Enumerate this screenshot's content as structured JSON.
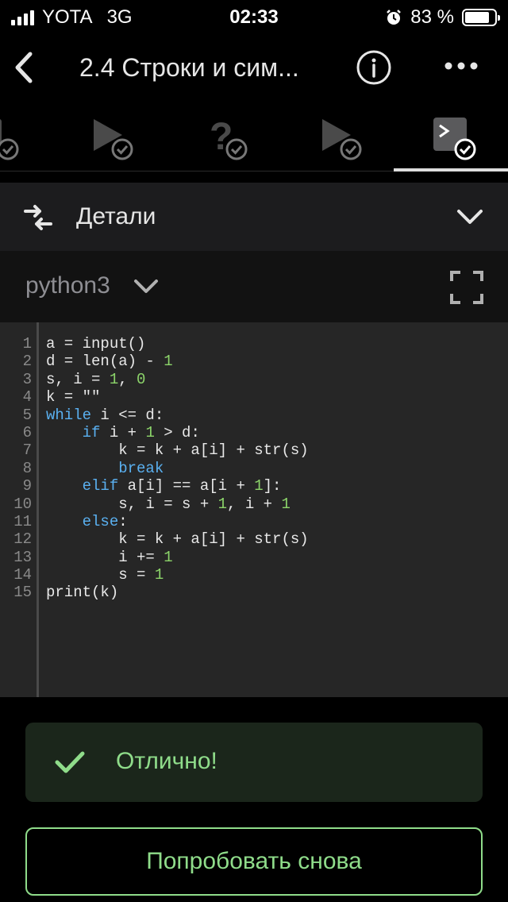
{
  "status_bar": {
    "carrier": "YOTA",
    "network": "3G",
    "time": "02:33",
    "battery_percent": "83 %",
    "battery_level": 0.83
  },
  "nav": {
    "title": "2.4 Строки и сим..."
  },
  "steps": [
    {
      "icon": "lesson-icon",
      "completed": true
    },
    {
      "icon": "video-play-icon",
      "completed": true
    },
    {
      "icon": "question-icon",
      "completed": true
    },
    {
      "icon": "video-play-icon",
      "completed": true
    },
    {
      "icon": "code-terminal-icon",
      "completed": true,
      "active": true
    }
  ],
  "details": {
    "label": "Детали"
  },
  "editor": {
    "language": "python3",
    "line_numbers": [
      "1",
      "2",
      "3",
      "4",
      "5",
      "6",
      "7",
      "8",
      "9",
      "10",
      "11",
      "12",
      "13",
      "14",
      "15"
    ]
  },
  "result": {
    "message": "Отлично!"
  },
  "actions": {
    "retry_label": "Попробовать снова"
  },
  "colors": {
    "success": "#8fdc8a",
    "keyword": "#5ab0f0",
    "number": "#8cd46a"
  }
}
